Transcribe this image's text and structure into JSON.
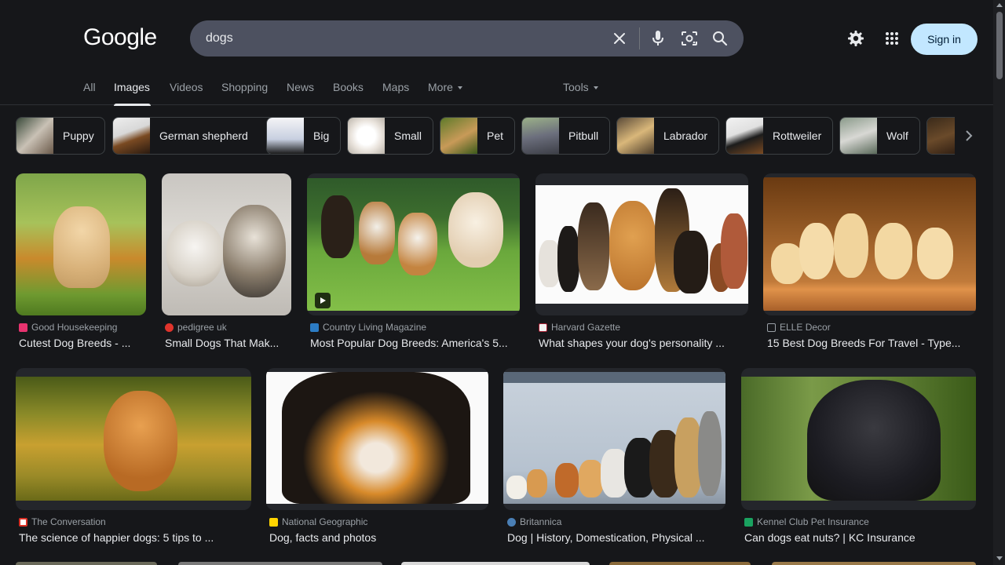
{
  "header": {
    "logo": "Google",
    "search_value": "dogs",
    "signin_label": "Sign in",
    "icons": {
      "clear": "close-icon",
      "voice": "mic-icon",
      "lens": "camera-lens-icon",
      "search": "search-icon",
      "settings": "gear-icon",
      "apps": "apps-grid-icon"
    }
  },
  "tabs": {
    "all": "All",
    "images": "Images",
    "videos": "Videos",
    "shopping": "Shopping",
    "news": "News",
    "books": "Books",
    "maps": "Maps",
    "more": "More",
    "tools": "Tools"
  },
  "chips": [
    "Puppy",
    "German shepherd",
    "Big",
    "Small",
    "Pet",
    "Pitbull",
    "Labrador",
    "Rottweiler",
    "Wolf"
  ],
  "results": [
    {
      "source": "Good Housekeeping",
      "title": "Cutest Dog Breeds - ...",
      "fav_color": "#e8336f"
    },
    {
      "source": "pedigree uk",
      "title": "Small Dogs That Mak...",
      "fav_color": "#e0342c"
    },
    {
      "source": "Country Living Magazine",
      "title": "Most Popular Dog Breeds: America's 5...",
      "fav_color": "#2c7cc4"
    },
    {
      "source": "Harvard Gazette",
      "title": "What shapes your dog's personality ...",
      "fav_color": "#f2f2f2"
    },
    {
      "source": "ELLE Decor",
      "title": "15 Best Dog Breeds For Travel - Type...",
      "fav_color": "#444"
    },
    {
      "source": "The Conversation",
      "title": "The science of happier dogs: 5 tips to ...",
      "fav_color": "#d93025"
    },
    {
      "source": "National Geographic",
      "title": "Dog, facts and photos",
      "fav_color": "#ffd400"
    },
    {
      "source": "Britannica",
      "title": "Dog | History, Domestication, Physical ...",
      "fav_color": "#4a7fb5"
    },
    {
      "source": "Kennel Club Pet Insurance",
      "title": "Can dogs eat nuts? | KC Insurance",
      "fav_color": "#1aa260"
    }
  ]
}
